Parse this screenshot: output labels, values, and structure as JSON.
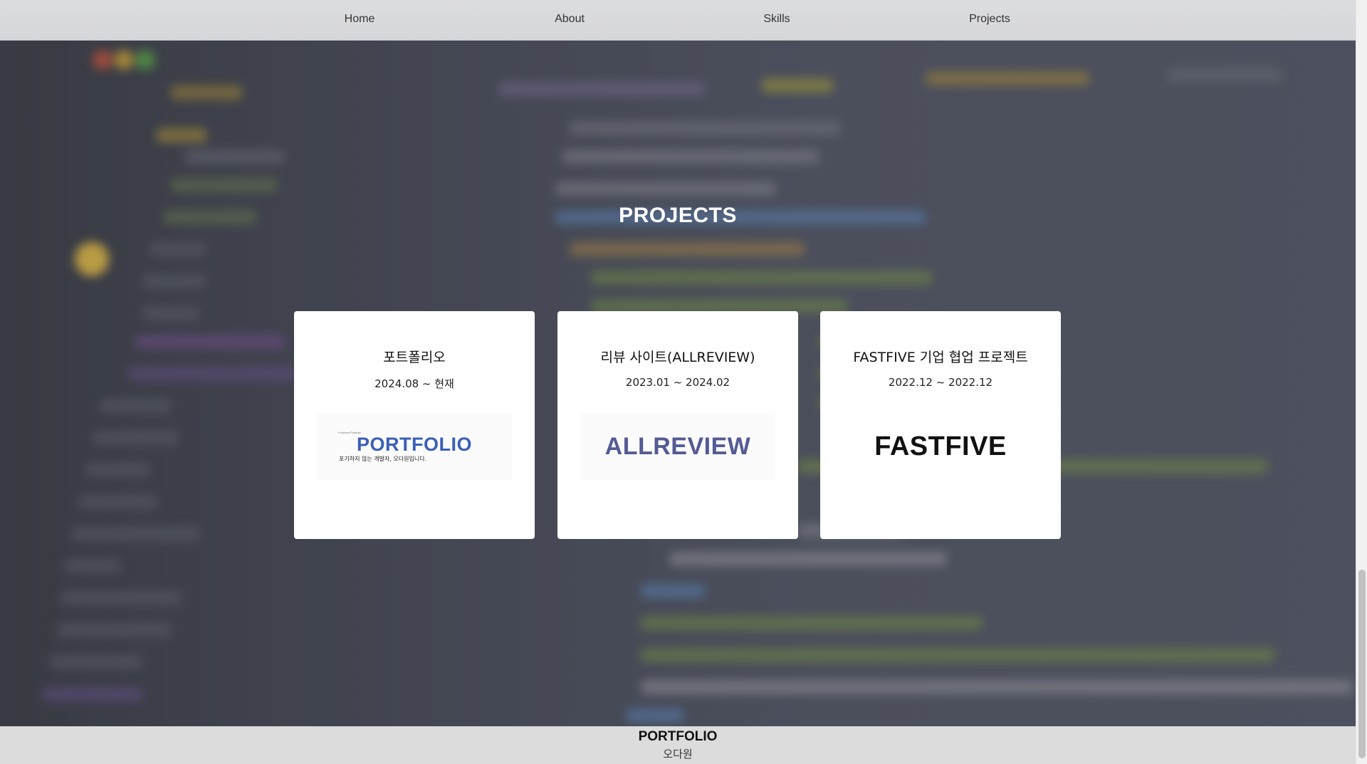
{
  "nav": {
    "items": [
      {
        "label": "Home"
      },
      {
        "label": "About"
      },
      {
        "label": "Skills"
      },
      {
        "label": "Projects"
      }
    ]
  },
  "projects": {
    "title": "PROJECTS",
    "cards": [
      {
        "title": "포트폴리오",
        "date": "2024.08 ~ 현재",
        "logo": {
          "tag": "Frontend Portfolio",
          "text": "PORTFOLIO",
          "sub": "포기하지 않는 개발자, 오다원입니다.",
          "color": "#3b5fb8"
        }
      },
      {
        "title": "리뷰 사이트(ALLREVIEW)",
        "date": "2023.01 ~ 2024.02",
        "logo": {
          "text": "ALLREVIEW",
          "color": "#545b93"
        }
      },
      {
        "title": "FASTFIVE 기업 협업 프로젝트",
        "date": "2022.12 ~ 2022.12",
        "logo": {
          "text": "FASTFIVE",
          "color": "#111111"
        }
      }
    ]
  },
  "footer": {
    "title": "PORTFOLIO",
    "name": "오다원"
  }
}
